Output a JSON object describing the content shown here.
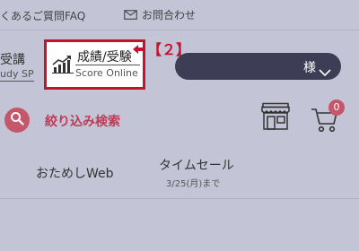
{
  "topbar": {
    "faq_label": "くあるご質問FAQ",
    "contact_label": "お問合わせ"
  },
  "study": {
    "main": "受講",
    "sub": "udy SP"
  },
  "score": {
    "main": "成績/受験",
    "sub": "Score Online"
  },
  "callout": {
    "label": "【２】"
  },
  "user": {
    "name": "様"
  },
  "search": {
    "label": "絞り込み検索"
  },
  "cart": {
    "count": "0"
  },
  "tabs": {
    "trial": "おためしWeb",
    "sale": "タイムセール",
    "sale_until": "3/25(月)まで"
  },
  "colors": {
    "accent_red": "#c4122f",
    "search_pink": "#c4576a",
    "user_pill": "#3d3d55",
    "background": "#c3c4d6"
  }
}
